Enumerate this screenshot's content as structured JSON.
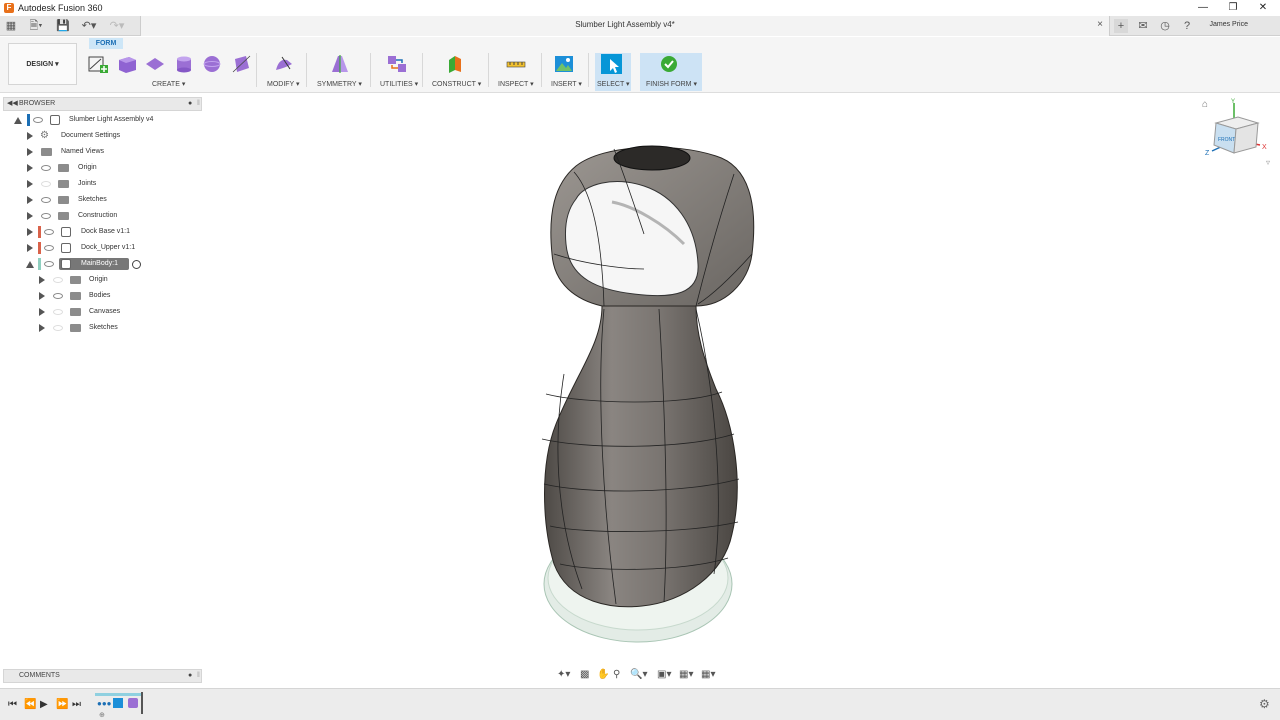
{
  "titlebar": {
    "app_title": "Autodesk Fusion 360",
    "minimize": "—",
    "restore": "❐",
    "close": "✕"
  },
  "tabbar": {
    "doc_title": "Slumber Light Assembly v4*",
    "doc_close": "×",
    "user_name": "James Price"
  },
  "toolbar": {
    "workspace": "DESIGN ▾",
    "active_tab": "FORM",
    "groups": [
      {
        "label": "CREATE ▾"
      },
      {
        "label": "MODIFY ▾"
      },
      {
        "label": "SYMMETRY ▾"
      },
      {
        "label": "UTILITIES ▾"
      },
      {
        "label": "CONSTRUCT ▾"
      },
      {
        "label": "INSPECT ▾"
      },
      {
        "label": "INSERT ▾"
      },
      {
        "label": "SELECT ▾"
      },
      {
        "label": "FINISH FORM ▾"
      }
    ]
  },
  "browser": {
    "title": "BROWSER",
    "items": [
      {
        "label": "Slumber Light Assembly v4"
      },
      {
        "label": "Document Settings"
      },
      {
        "label": "Named Views"
      },
      {
        "label": "Origin"
      },
      {
        "label": "Joints"
      },
      {
        "label": "Sketches"
      },
      {
        "label": "Construction"
      },
      {
        "label": "Dock Base v1:1"
      },
      {
        "label": "Dock_Upper v1:1"
      },
      {
        "label": "MainBody:1"
      },
      {
        "label": "Origin"
      },
      {
        "label": "Bodies"
      },
      {
        "label": "Canvases"
      },
      {
        "label": "Sketches"
      }
    ]
  },
  "comments": {
    "title": "COMMENTS"
  },
  "viewcube": {
    "face": "FRONT",
    "axis_x": "X",
    "axis_y": "Y",
    "axis_z": "Z"
  },
  "colors": {
    "accent": "#0696d7",
    "form_purple": "#9b6fd4",
    "finish_green": "#3aaa35",
    "body_gray": "#6e6a66"
  }
}
